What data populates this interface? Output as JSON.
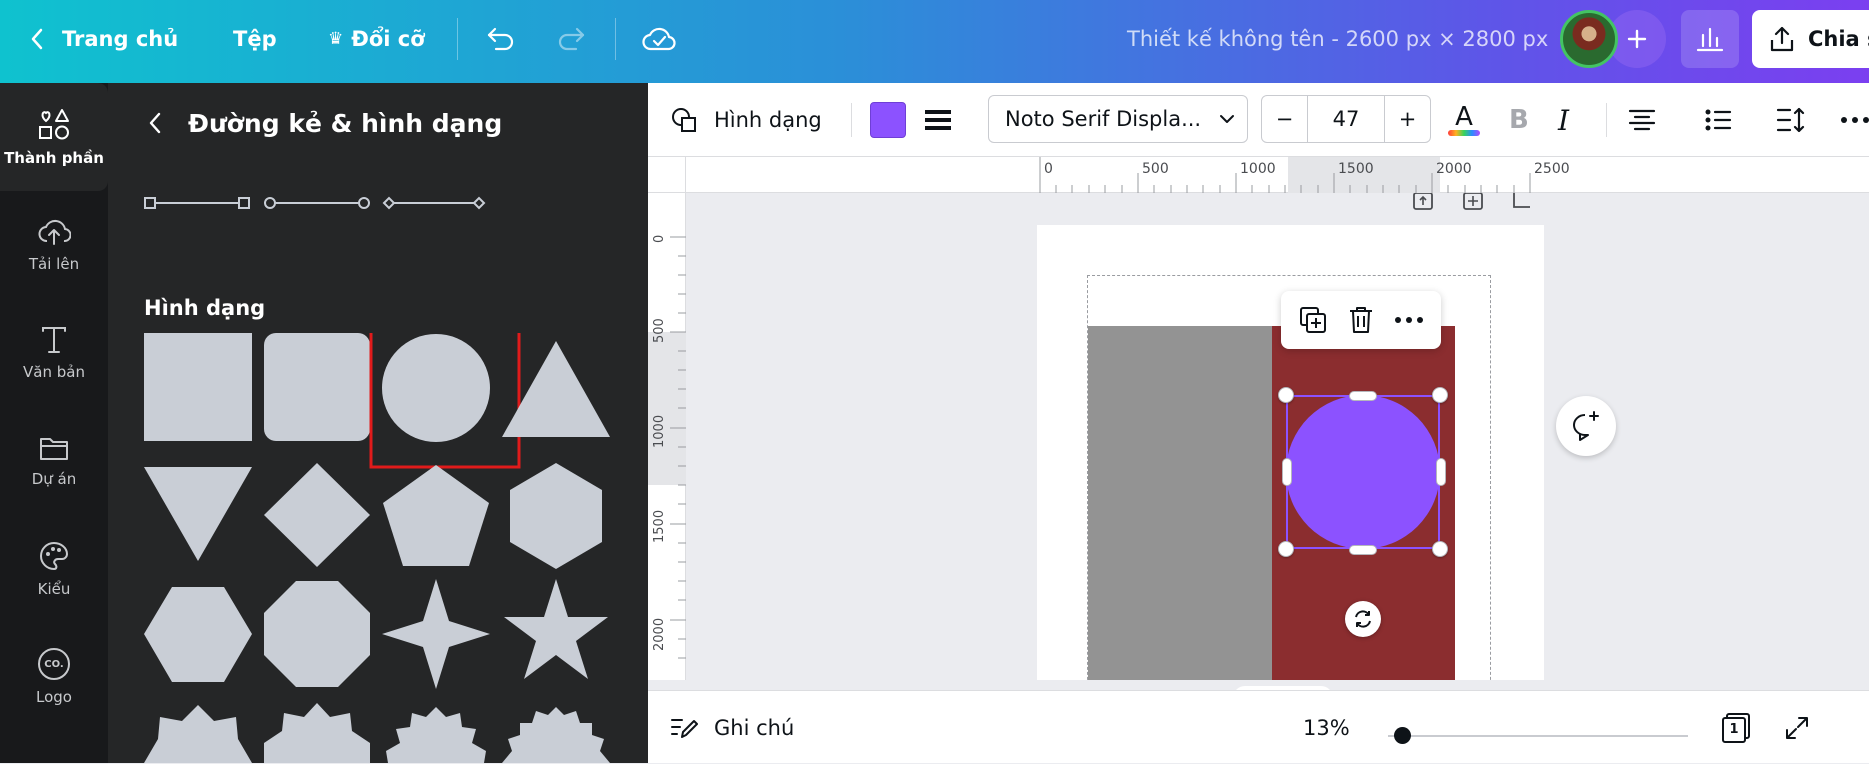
{
  "topbar": {
    "back_label": "Trang chủ",
    "file_label": "Tệp",
    "resize_label": "Đổi cỡ",
    "crown_icon": "♛",
    "design_title": "Thiết kế không tên - 2600 px × 2800 px",
    "share_label": "Chia s"
  },
  "rail": {
    "items": [
      {
        "label": "Thành phần",
        "icon": "elements-icon"
      },
      {
        "label": "Tải lên",
        "icon": "upload-cloud-icon"
      },
      {
        "label": "Văn bản",
        "icon": "text-icon"
      },
      {
        "label": "Dự án",
        "icon": "folder-icon"
      },
      {
        "label": "Kiểu",
        "icon": "palette-icon"
      },
      {
        "label": "Logo",
        "icon": "logo-icon"
      }
    ],
    "logo_text": "CO."
  },
  "panel": {
    "title": "Đường kẻ & hình dạng",
    "section_title": "Hình dạng"
  },
  "toolbar": {
    "shape_label": "Hình dạng",
    "fill_color": "#8c52ff",
    "font_name": "Noto Serif Displa...",
    "font_size": "47",
    "minus": "−",
    "plus": "+",
    "text_color_letter": "A",
    "bold_letter": "B",
    "italic_letter": "I"
  },
  "ruler": {
    "h_ticks": [
      "0",
      "500",
      "1000",
      "1500",
      "2000",
      "2500"
    ],
    "v_ticks": [
      "0",
      "500",
      "1000",
      "1500",
      "2000"
    ]
  },
  "canvas": {
    "page_color": "#ffffff",
    "gray_color": "#939393",
    "red_color": "#8b2d2f",
    "circle_color": "#8c52ff"
  },
  "bottombar": {
    "notes_label": "Ghi chú",
    "zoom": "13%",
    "zoom_fraction": 0.13,
    "page_number": "1"
  }
}
